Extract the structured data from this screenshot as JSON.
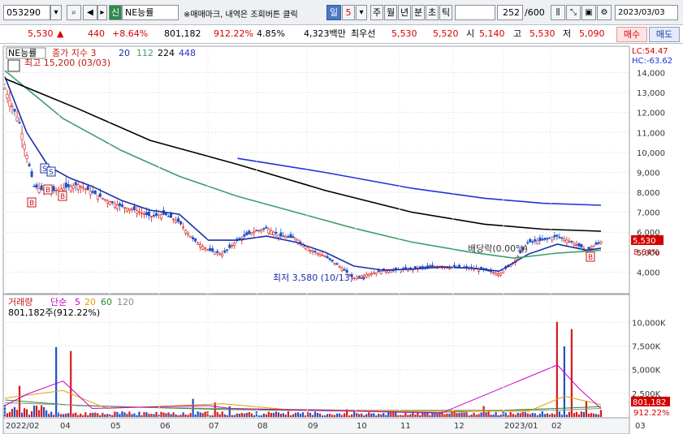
{
  "toolbar": {
    "code": "053290",
    "icon_a": "search-icon",
    "badge": "신",
    "name": "NE능률",
    "notice": "※매매마크, 내역은 조회버튼 클릭",
    "period_buttons": [
      "일",
      "5",
      "주",
      "월",
      "년",
      "분",
      "초",
      "틱"
    ],
    "active_period": "일",
    "count": "252",
    "count_max": "/600",
    "date": "2023/03/03"
  },
  "quote": {
    "price": "5,530",
    "change_arrow": "▲",
    "change": "440",
    "change_pct": "+8.64%",
    "volume": "801,182",
    "volume_ratio": "912.22%",
    "turnover": "4.85%",
    "amount": "4,323백만",
    "best_ask_label": "최우선",
    "best_ask": "5,530",
    "best_bid": "5,520",
    "open_label": "시",
    "open": "5,140",
    "high_label": "고",
    "high": "5,530",
    "low_label": "저",
    "low": "5,090",
    "buy_label": "매수",
    "sell_label": "매도"
  },
  "price_panel": {
    "stock_label": "NE능률",
    "ma_label": "종가 지수 3",
    "ma_periods": [
      "20",
      "112",
      "224",
      "448"
    ],
    "ma_colors": [
      "#1a2fa8",
      "#3aa06a",
      "#000000",
      "#1f33d9"
    ],
    "high_marker": "최고 15,200 (03/03)",
    "low_marker": "최저 3,580 (10/13)",
    "dividend_marker": "배당락(0.00%)",
    "lc": "LC:54.47",
    "hc": "HC:-63.62",
    "current_price_tag": "5,530",
    "current_pct_tag": "8.64%"
  },
  "volume_panel": {
    "label": "거래량",
    "ma_label": "단순",
    "ma_periods": [
      "5",
      "20",
      "60",
      "120"
    ],
    "ma_colors": [
      "#cc00cc",
      "#e0a000",
      "#2a8a2a",
      "#8a8a8a"
    ],
    "current": "801,182주(912.22%)",
    "current_tag": "801,182",
    "pct_tag": "912.22%"
  },
  "chart_data": [
    {
      "type": "line",
      "title": "NE능률",
      "y_ticks": [
        4000,
        5000,
        6000,
        7000,
        8000,
        9000,
        10000,
        11000,
        12000,
        13000,
        14000
      ],
      "ylim": [
        3000,
        15200
      ],
      "x_ticks": [
        "2022/02",
        "04",
        "05",
        "06",
        "07",
        "08",
        "09",
        "10",
        "11",
        "12",
        "2023/01",
        "02",
        "03"
      ],
      "series": [
        {
          "name": "종가",
          "color": "#c01818",
          "points": [
            [
              0,
              13200
            ],
            [
              2,
              11500
            ],
            [
              4,
              8300
            ],
            [
              6,
              8000
            ],
            [
              8,
              8200
            ],
            [
              10,
              8400
            ],
            [
              12,
              8000
            ],
            [
              14,
              7600
            ],
            [
              16,
              7300
            ],
            [
              18,
              7100
            ],
            [
              20,
              6800
            ],
            [
              22,
              6900
            ],
            [
              24,
              6500
            ],
            [
              26,
              5600
            ],
            [
              28,
              5100
            ],
            [
              30,
              4900
            ],
            [
              32,
              5600
            ],
            [
              34,
              6000
            ],
            [
              36,
              6200
            ],
            [
              38,
              5800
            ],
            [
              40,
              5700
            ],
            [
              42,
              5100
            ],
            [
              44,
              4800
            ],
            [
              46,
              4300
            ],
            [
              48,
              3700
            ],
            [
              50,
              3900
            ],
            [
              52,
              4050
            ],
            [
              54,
              4100
            ],
            [
              56,
              4150
            ],
            [
              58,
              4250
            ],
            [
              60,
              4300
            ],
            [
              62,
              4250
            ],
            [
              64,
              4200
            ],
            [
              66,
              4100
            ],
            [
              68,
              3900
            ],
            [
              70,
              4500
            ],
            [
              72,
              5500
            ],
            [
              74,
              5600
            ],
            [
              76,
              5800
            ],
            [
              78,
              5500
            ],
            [
              80,
              5100
            ],
            [
              82,
              5530
            ]
          ]
        },
        {
          "name": "20",
          "color": "#1a2fa8",
          "points": [
            [
              0,
              13800
            ],
            [
              3,
              11000
            ],
            [
              6,
              9300
            ],
            [
              9,
              8700
            ],
            [
              12,
              8300
            ],
            [
              16,
              7600
            ],
            [
              20,
              7100
            ],
            [
              24,
              6900
            ],
            [
              28,
              5600
            ],
            [
              32,
              5600
            ],
            [
              36,
              5800
            ],
            [
              40,
              5500
            ],
            [
              44,
              5000
            ],
            [
              48,
              4300
            ],
            [
              52,
              4100
            ],
            [
              56,
              4150
            ],
            [
              60,
              4250
            ],
            [
              64,
              4200
            ],
            [
              68,
              4050
            ],
            [
              72,
              4900
            ],
            [
              76,
              5400
            ],
            [
              80,
              5100
            ],
            [
              82,
              5200
            ]
          ]
        },
        {
          "name": "112",
          "color": "#3aa06a",
          "points": [
            [
              0,
              14100
            ],
            [
              8,
              11700
            ],
            [
              16,
              10100
            ],
            [
              24,
              8800
            ],
            [
              32,
              7800
            ],
            [
              40,
              7000
            ],
            [
              48,
              6200
            ],
            [
              56,
              5500
            ],
            [
              64,
              5000
            ],
            [
              70,
              4700
            ],
            [
              76,
              4950
            ],
            [
              82,
              5100
            ]
          ]
        },
        {
          "name": "224",
          "color": "#000000",
          "points": [
            [
              0,
              13700
            ],
            [
              10,
              12200
            ],
            [
              20,
              10600
            ],
            [
              32,
              9400
            ],
            [
              44,
              8100
            ],
            [
              56,
              7000
            ],
            [
              66,
              6400
            ],
            [
              74,
              6150
            ],
            [
              82,
              6050
            ]
          ]
        },
        {
          "name": "448",
          "color": "#1f33d9",
          "points": [
            [
              32,
              9700
            ],
            [
              44,
              9000
            ],
            [
              56,
              8200
            ],
            [
              66,
              7700
            ],
            [
              74,
              7450
            ],
            [
              82,
              7350
            ]
          ]
        }
      ]
    },
    {
      "type": "bar",
      "title": "거래량",
      "y_ticks": [
        "2,500K",
        "5,000K",
        "7,500K",
        "10,000K"
      ],
      "ylim": [
        0,
        11500
      ],
      "unit": "K"
    }
  ]
}
